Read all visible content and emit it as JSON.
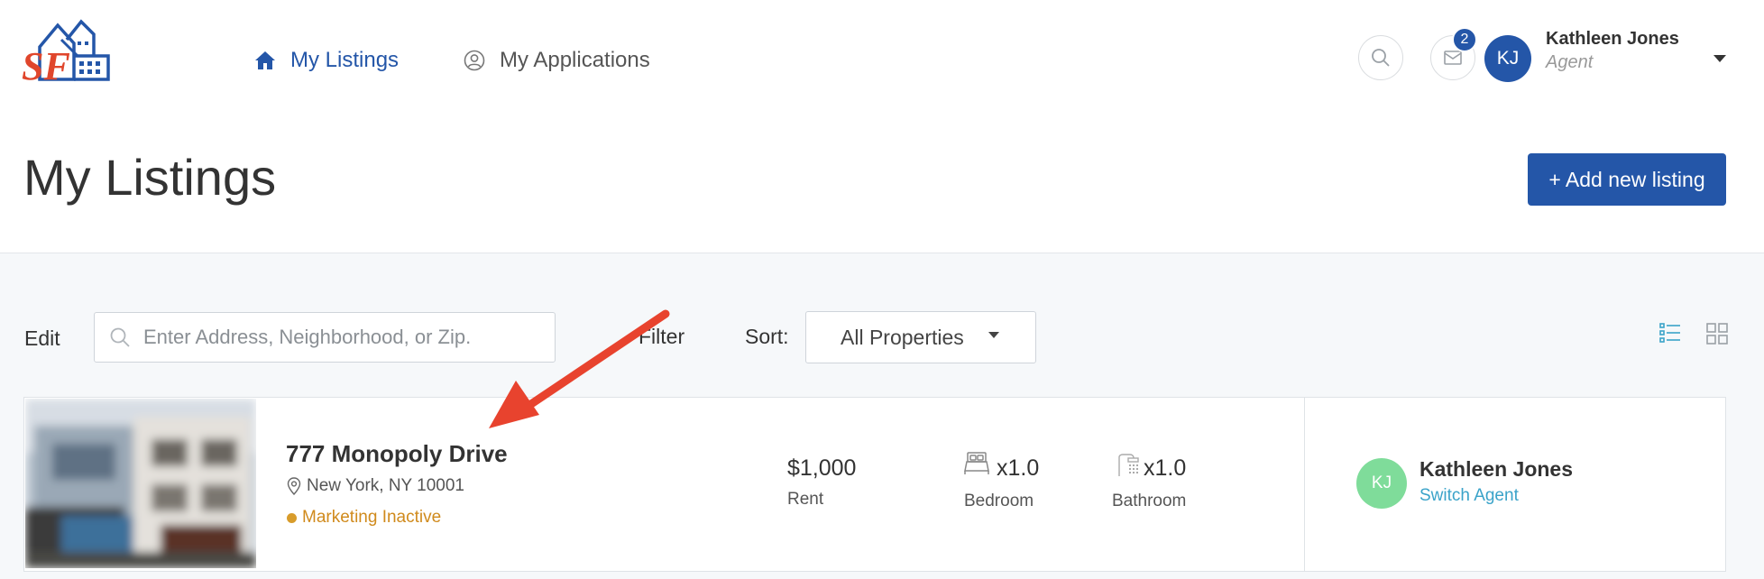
{
  "brand": {
    "logo_letters": "SF",
    "accent": "#2456a8"
  },
  "nav": {
    "items": [
      {
        "label": "My Listings",
        "icon": "home-icon",
        "active": true
      },
      {
        "label": "My Applications",
        "icon": "user-circle-icon",
        "active": false
      }
    ]
  },
  "header_tools": {
    "search_icon": "search-icon",
    "mail_icon": "mail-icon",
    "notification_count": "2"
  },
  "user": {
    "initials": "KJ",
    "name": "Kathleen Jones",
    "role": "Agent"
  },
  "page": {
    "title": "My Listings",
    "add_button": "+ Add new listing"
  },
  "toolbar": {
    "edit_label": "Edit",
    "search_placeholder": "Enter Address, Neighborhood, or Zip.",
    "filter_label": "Filter",
    "sort_label": "Sort:",
    "sort_value": "All Properties",
    "view_icons": [
      "list-view-icon",
      "grid-view-icon"
    ]
  },
  "listing": {
    "title": "777 Monopoly Drive",
    "location": "New York, NY 10001",
    "status": "Marketing Inactive",
    "status_color": "#d08a1c",
    "rent_value": "$1,000",
    "rent_label": "Rent",
    "bedroom_value": "x1.0",
    "bedroom_label": "Bedroom",
    "bathroom_value": "x1.0",
    "bathroom_label": "Bathroom",
    "agent": {
      "initials": "KJ",
      "name": "Kathleen Jones",
      "switch_label": "Switch Agent"
    }
  },
  "annotation": {
    "type": "red-arrow",
    "color": "#e8432e"
  }
}
